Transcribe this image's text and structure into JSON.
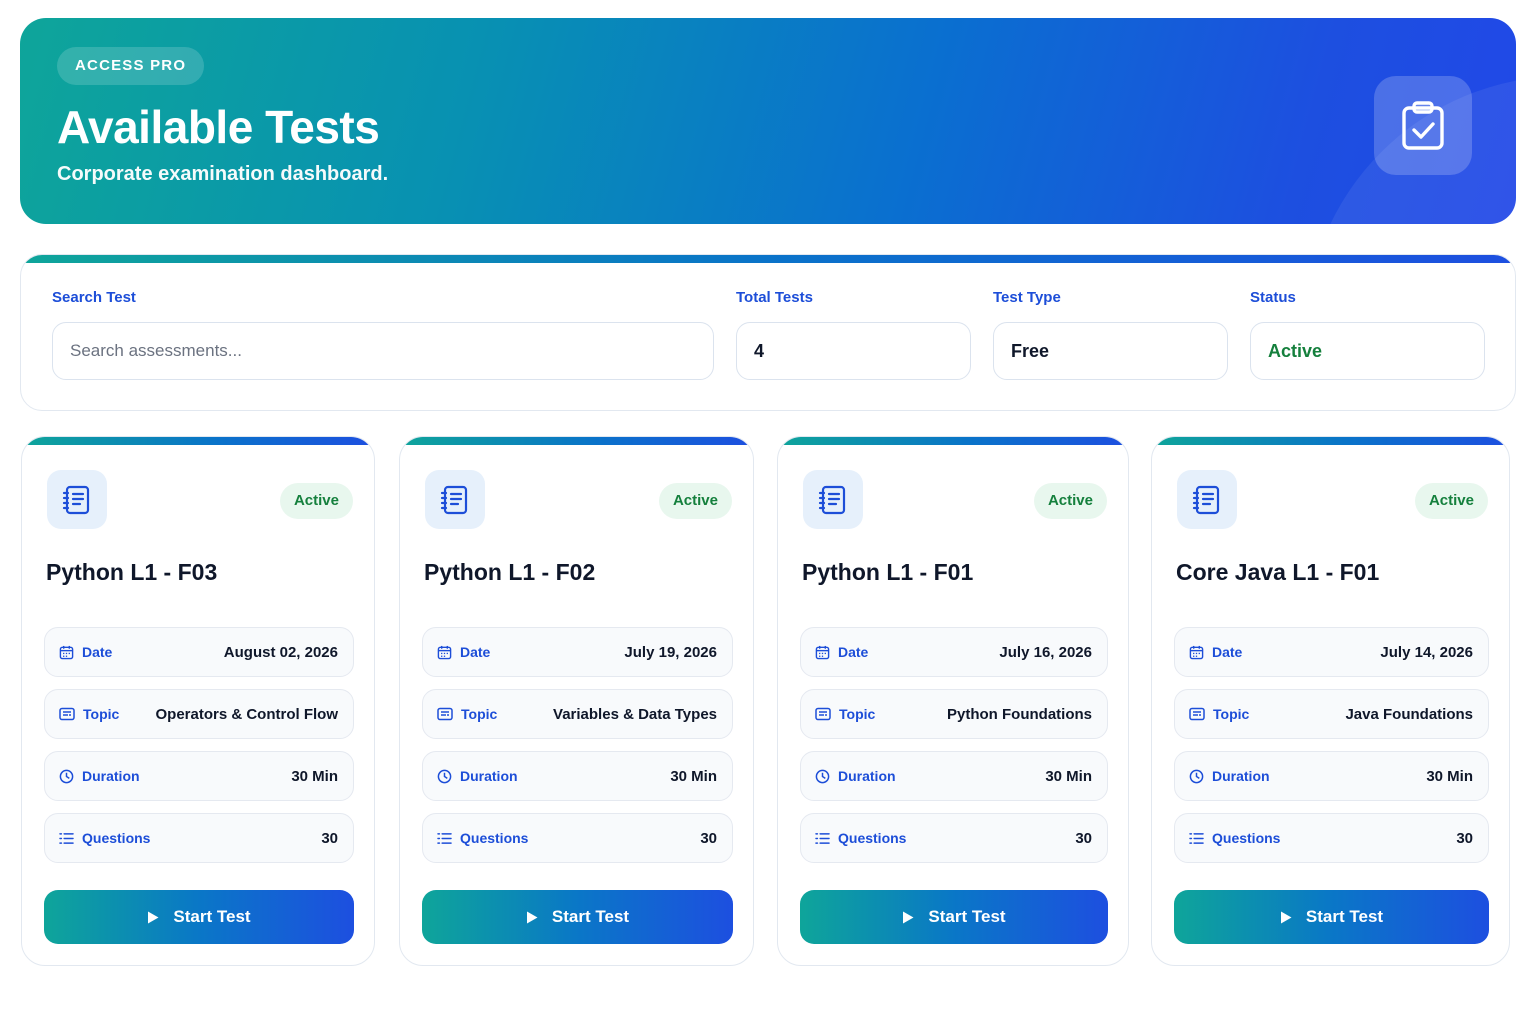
{
  "hero": {
    "badge": "ACCESS PRO",
    "title": "Available Tests",
    "subtitle": "Corporate examination dashboard.",
    "icon": "clipboard-check-icon"
  },
  "filters": {
    "search": {
      "label": "Search Test",
      "placeholder": "Search assessments..."
    },
    "total": {
      "label": "Total Tests",
      "value": "4"
    },
    "type": {
      "label": "Test Type",
      "value": "Free"
    },
    "status": {
      "label": "Status",
      "value": "Active"
    }
  },
  "labels": {
    "date": "Date",
    "topic": "Topic",
    "duration": "Duration",
    "questions": "Questions",
    "start": "Start Test"
  },
  "cards": [
    {
      "title": "Python L1 - F03",
      "status": "Active",
      "date": "August 02, 2026",
      "topic": "Operators & Control Flow",
      "duration": "30 Min",
      "questions": "30"
    },
    {
      "title": "Python L1 - F02",
      "status": "Active",
      "date": "July 19, 2026",
      "topic": "Variables & Data Types",
      "duration": "30 Min",
      "questions": "30"
    },
    {
      "title": "Python L1 - F01",
      "status": "Active",
      "date": "July 16, 2026",
      "topic": "Python Foundations",
      "duration": "30 Min",
      "questions": "30"
    },
    {
      "title": "Core Java L1 - F01",
      "status": "Active",
      "date": "July 14, 2026",
      "topic": "Java Foundations",
      "duration": "30 Min",
      "questions": "30"
    }
  ],
  "colors": {
    "accent_teal": "#0ea59a",
    "accent_blue": "#1d4fe0",
    "label_blue": "#1d4ed8",
    "active_green": "#15803d"
  }
}
